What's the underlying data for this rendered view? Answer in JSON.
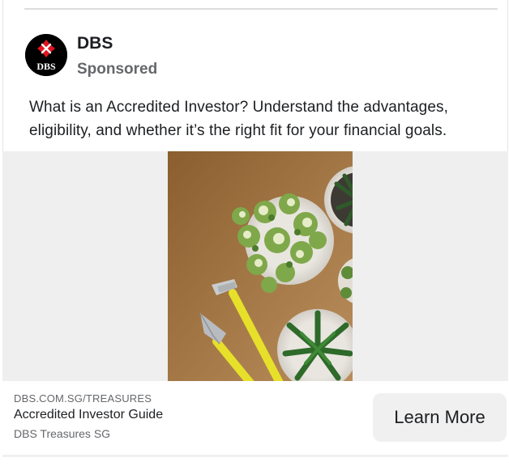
{
  "post": {
    "advertiser_name": "DBS",
    "sponsored_label": "Sponsored",
    "avatar_logo_text": "DBS",
    "caption": "What is an Accredited Investor? Understand the advantages, eligibility, and whether it’s the right fit for your financial goals."
  },
  "media": {
    "icon": "potted-plants-photo",
    "colors": {
      "background": "#efefef",
      "photo_backdrop": "#9c7442"
    }
  },
  "link": {
    "domain": "DBS.COM.SG/TREASURES",
    "title": "Accredited Investor Guide",
    "subtitle": "DBS Treasures SG",
    "cta_label": "Learn More"
  },
  "colors": {
    "brand_red": "#e1141e",
    "secondary_text": "#65676b",
    "cta_bg": "#f0f0f0"
  }
}
